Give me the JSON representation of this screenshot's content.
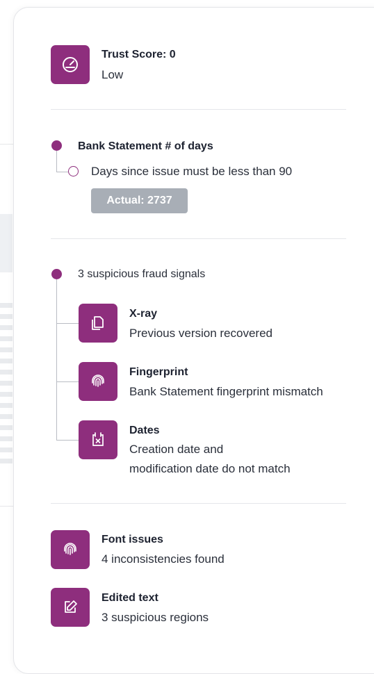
{
  "trust": {
    "title": "Trust Score: 0",
    "level": "Low",
    "icon": "gauge-icon"
  },
  "rule": {
    "title": "Bank Statement # of days",
    "condition": "Days since issue must be less than 90",
    "actual": "Actual: 2737"
  },
  "fraud": {
    "summary": "3 suspicious fraud signals",
    "signals": [
      {
        "title": "X-ray",
        "desc": "Previous version recovered",
        "icon": "copy-icon"
      },
      {
        "title": "Fingerprint",
        "desc": "Bank Statement fingerprint mismatch",
        "icon": "fingerprint-icon"
      },
      {
        "title": "Dates",
        "desc_line1": "Creation date and",
        "desc_line2": "modification date do not match",
        "icon": "calendar-x-icon"
      }
    ]
  },
  "issues": [
    {
      "title": "Font issues",
      "desc": "4 inconsistencies found",
      "icon": "fingerprint-icon"
    },
    {
      "title": "Edited text",
      "desc": "3 suspicious regions",
      "icon": "edit-icon"
    }
  ],
  "colors": {
    "accent": "#8e2e7d",
    "badge": "#a8aeb6"
  }
}
